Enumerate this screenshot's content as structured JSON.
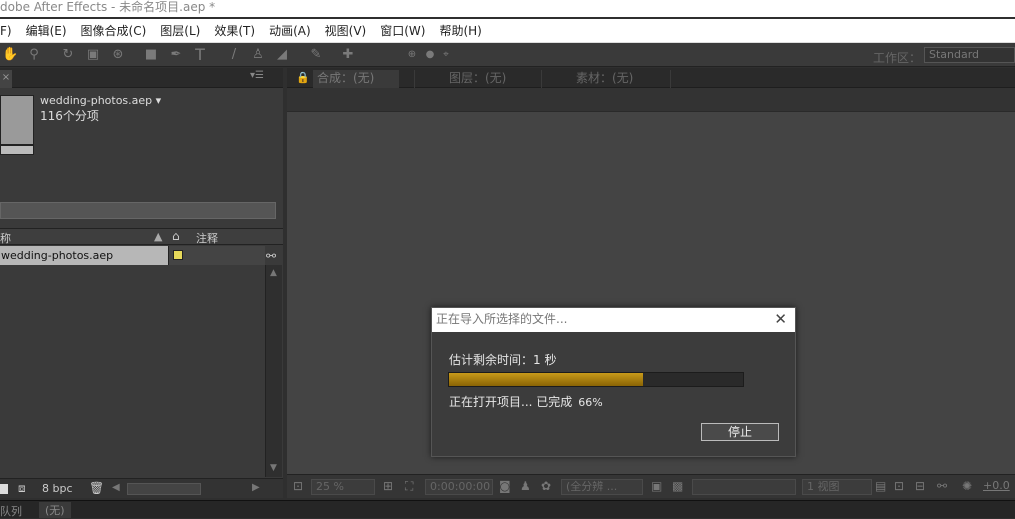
{
  "window": {
    "title": "dobe After Effects - 未命名项目.aep *"
  },
  "menu": [
    "F)",
    "编辑(E)",
    "图像合成(C)",
    "图层(L)",
    "效果(T)",
    "动画(A)",
    "视图(V)",
    "窗口(W)",
    "帮助(H)"
  ],
  "toolbar": {
    "workspace_label": "工作区：",
    "workspace_value": "Standard",
    "tools": [
      "hand-icon",
      "zoom-icon",
      "rotate-icon",
      "camera-orbit-icon",
      "pan-behind-icon",
      "rectangle-mask-icon",
      "pen-icon",
      "text-icon",
      "brush-icon",
      "clone-stamp-icon",
      "eraser-icon",
      "roto-brush-icon",
      "puppet-pin-icon"
    ]
  },
  "project": {
    "name": "wedding-photos.aep ▾",
    "count": "116个分项",
    "col_name": "称",
    "col_comment": "注释",
    "row_name": "wedding-photos.aep",
    "label_color": "#e6d95a",
    "bpc": "8 bpc"
  },
  "viewer": {
    "tab_comp": "合成：(无)",
    "tab_layer": "图层：(无)",
    "tab_footage": "素材：(无)",
    "zoom": "25 %",
    "timecode": "0:00:00:00",
    "resolution": "(全分辨 ...",
    "views": "1 视图",
    "exposure": "+0.0"
  },
  "bottom": {
    "panel1": "队列",
    "panel2": "(无)"
  },
  "dialog": {
    "title": "正在导入所选择的文件...",
    "time_remaining": "估计剩余时间：1 秒",
    "status": "正在打开项目... 已完成",
    "percent_text": "66%",
    "progress": 0.66,
    "stop_label": "停止"
  }
}
